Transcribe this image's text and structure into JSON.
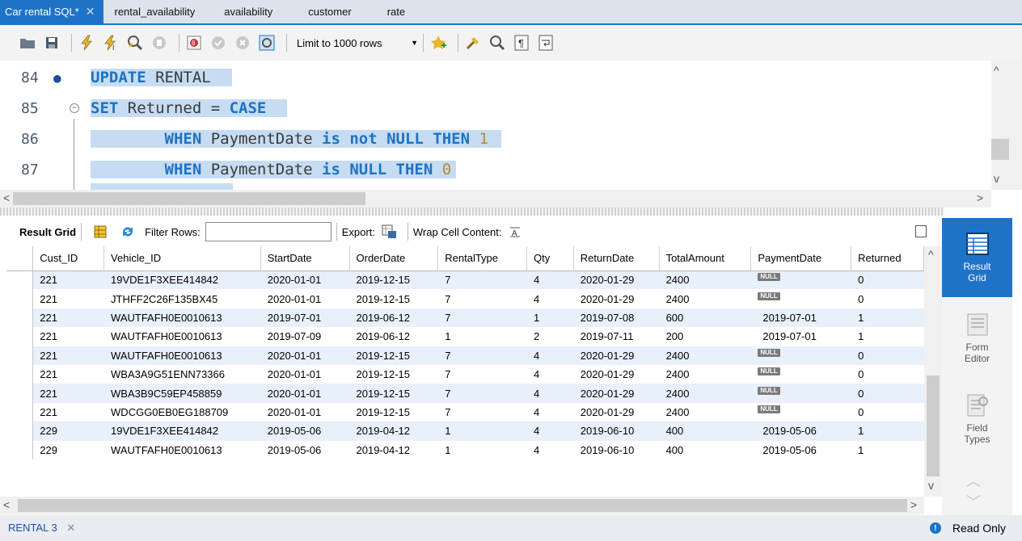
{
  "tabs": [
    {
      "label": "Car rental SQL*",
      "active": true
    },
    {
      "label": "rental_availability"
    },
    {
      "label": "availability"
    },
    {
      "label": "customer"
    },
    {
      "label": "rate"
    }
  ],
  "toolbar": {
    "limit_label": "Limit to 1000 rows"
  },
  "editor": {
    "lines": [
      {
        "num": "84",
        "tokens": [
          {
            "t": "UPDATE",
            "k": "kw"
          },
          {
            "t": " RENTAL",
            "k": "id"
          }
        ]
      },
      {
        "num": "85",
        "tokens": [
          {
            "t": "SET",
            "k": "kw"
          },
          {
            "t": " Returned = ",
            "k": "id"
          },
          {
            "t": "CASE",
            "k": "kw"
          }
        ]
      },
      {
        "num": "86",
        "tokens": [
          {
            "t": "        WHEN",
            "k": "kw"
          },
          {
            "t": " PaymentDate ",
            "k": "id"
          },
          {
            "t": "is not NULL THEN",
            "k": "kw"
          },
          {
            "t": " 1",
            "k": "num"
          }
        ]
      },
      {
        "num": "87",
        "tokens": [
          {
            "t": "        WHEN",
            "k": "kw"
          },
          {
            "t": " PaymentDate ",
            "k": "id"
          },
          {
            "t": "is NULL THEN",
            "k": "kw"
          },
          {
            "t": " 0",
            "k": "num"
          }
        ]
      }
    ]
  },
  "result_toolbar": {
    "result_grid_label": "Result Grid",
    "filter_label": "Filter Rows:",
    "filter_value": "",
    "export_label": "Export:",
    "wrap_label": "Wrap Cell Content:"
  },
  "grid": {
    "columns": [
      "Cust_ID",
      "Vehicle_ID",
      "StartDate",
      "OrderDate",
      "RentalType",
      "Qty",
      "ReturnDate",
      "TotalAmount",
      "PaymentDate",
      "Returned"
    ],
    "null_label": "NULL",
    "rows": [
      [
        "221",
        "19VDE1F3XEE414842",
        "2020-01-01",
        "2019-12-15",
        "7",
        "4",
        "2020-01-29",
        "2400",
        null,
        "0"
      ],
      [
        "221",
        "JTHFF2C26F135BX45",
        "2020-01-01",
        "2019-12-15",
        "7",
        "4",
        "2020-01-29",
        "2400",
        null,
        "0"
      ],
      [
        "221",
        "WAUTFAFH0E0010613",
        "2019-07-01",
        "2019-06-12",
        "7",
        "1",
        "2019-07-08",
        "600",
        "2019-07-01",
        "1"
      ],
      [
        "221",
        "WAUTFAFH0E0010613",
        "2019-07-09",
        "2019-06-12",
        "1",
        "2",
        "2019-07-11",
        "200",
        "2019-07-01",
        "1"
      ],
      [
        "221",
        "WAUTFAFH0E0010613",
        "2020-01-01",
        "2019-12-15",
        "7",
        "4",
        "2020-01-29",
        "2400",
        null,
        "0"
      ],
      [
        "221",
        "WBA3A9G51ENN73366",
        "2020-01-01",
        "2019-12-15",
        "7",
        "4",
        "2020-01-29",
        "2400",
        null,
        "0"
      ],
      [
        "221",
        "WBA3B9C59EP458859",
        "2020-01-01",
        "2019-12-15",
        "7",
        "4",
        "2020-01-29",
        "2400",
        null,
        "0"
      ],
      [
        "221",
        "WDCGG0EB0EG188709",
        "2020-01-01",
        "2019-12-15",
        "7",
        "4",
        "2020-01-29",
        "2400",
        null,
        "0"
      ],
      [
        "229",
        "19VDE1F3XEE414842",
        "2019-05-06",
        "2019-04-12",
        "1",
        "4",
        "2019-06-10",
        "400",
        "2019-05-06",
        "1"
      ],
      [
        "229",
        "WAUTFAFH0E0010613",
        "2019-05-06",
        "2019-04-12",
        "1",
        "4",
        "2019-06-10",
        "400",
        "2019-05-06",
        "1"
      ]
    ]
  },
  "side_panel": {
    "result_grid": "Result Grid",
    "form_editor": "Form Editor",
    "field_types": "Field Types"
  },
  "bottom": {
    "tab_label": "RENTAL 3",
    "status": "Read Only"
  },
  "colors": {
    "accent": "#1e73c8",
    "selection": "#c6dcf3",
    "keyword": "#1f73c2",
    "row_alt": "#e8f0fb"
  }
}
